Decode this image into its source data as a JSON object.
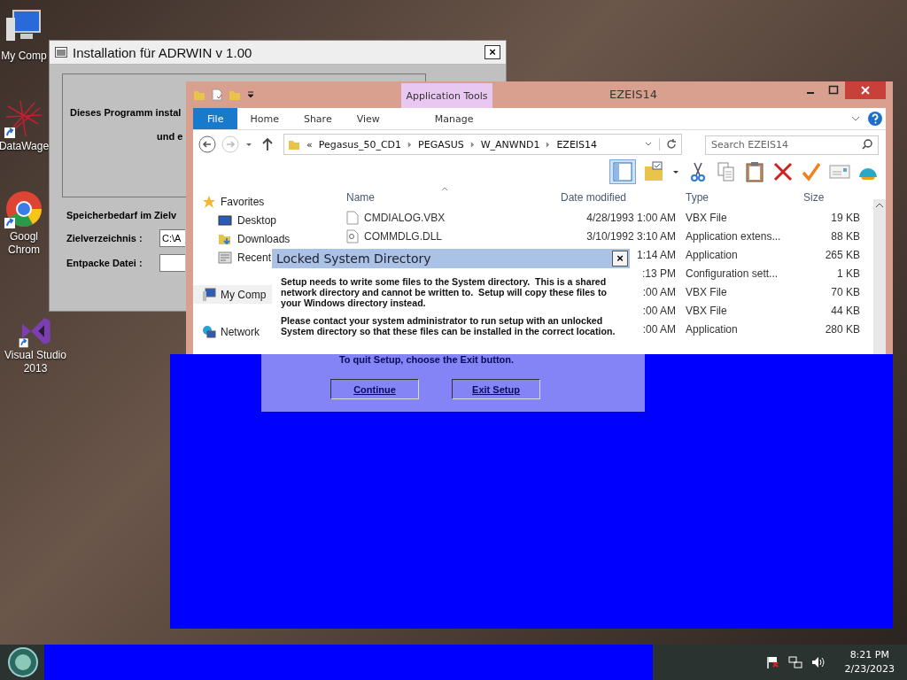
{
  "desktop_icons": [
    {
      "kind": "computer",
      "label": "My Comp",
      "shortcut": false
    },
    {
      "kind": "network-graph",
      "label": "DataWage",
      "shortcut": true
    },
    {
      "kind": "browser",
      "label": "Googl Chrom",
      "shortcut": true
    },
    {
      "kind": "ide",
      "label": "Visual Studio 2013",
      "shortcut": true
    }
  ],
  "installer": {
    "title": "Installation für ADRWIN v 1.00",
    "close": "×",
    "intro_lines": [
      "Dieses Programm instal",
      "und e"
    ],
    "space_label": "Speicherbedarf im Zielv",
    "fields": [
      {
        "label": "Zielverzeichnis :",
        "value": "C:\\A"
      },
      {
        "label": "Entpacke Datei :"
      }
    ]
  },
  "explorer": {
    "title": "EZEIS14",
    "context_tab": "Application Tools",
    "tabs": [
      {
        "label": "File",
        "selected": true
      },
      {
        "label": "Home",
        "selected": false
      },
      {
        "label": "Share",
        "selected": false
      },
      {
        "label": "View",
        "selected": false
      },
      {
        "label": "Manage",
        "selected": false
      }
    ],
    "breadcrumb": {
      "overflow": "«",
      "parts": [
        "Pegasus_50_CD1",
        "PEGASUS",
        "W_ANWND1",
        "EZEIS14"
      ]
    },
    "search": {
      "placeholder": "Search EZEIS14"
    },
    "nav": [
      {
        "kind": "star",
        "label": "Favorites",
        "group": true
      },
      {
        "kind": "desktop",
        "label": "Desktop",
        "group": false
      },
      {
        "kind": "downloads",
        "label": "Downloads",
        "group": false
      },
      {
        "kind": "recent",
        "label": "Recent",
        "group": false
      },
      {
        "kind": "computer",
        "label": "My Comp",
        "group": true
      },
      {
        "kind": "network",
        "label": "Network",
        "group": true
      }
    ],
    "columns": [
      "Name",
      "Date modified",
      "Type",
      "Size"
    ],
    "rows": [
      {
        "kind": "file",
        "name": "CMDIALOG.VBX",
        "date": "4/28/1993 1:00 AM",
        "type": "VBX File",
        "size": "19 KB"
      },
      {
        "kind": "dll",
        "name": "COMMDLG.DLL",
        "date": "3/10/1992 3:10 AM",
        "type": "Application extens...",
        "size": "88 KB"
      },
      {
        "kind": "hidden",
        "date": "1:14 AM",
        "type": "Application",
        "size": "265 KB"
      },
      {
        "kind": "hidden",
        "date": ":13 PM",
        "type": "Configuration sett...",
        "size": "1 KB"
      },
      {
        "kind": "hidden",
        "date": ":00 AM",
        "type": "VBX File",
        "size": "70 KB"
      },
      {
        "kind": "hidden",
        "date": ":00 AM",
        "type": "VBX File",
        "size": "44 KB"
      },
      {
        "kind": "hidden",
        "date": ":00 AM",
        "type": "Application",
        "size": "280 KB"
      }
    ]
  },
  "dialog": {
    "title": "Locked System Directory",
    "close": "×",
    "paragraphs": [
      "Setup needs to write some files to the System directory.  This is a shared network directory and cannot be written to.  Setup will copy these files to your Windows directory instead.",
      "Please contact your system administrator to run setup with an unlocked System directory so that these files can be installed in the correct location."
    ],
    "quit_text": "To quit Setup, choose the Exit button.",
    "buttons": [
      "Continue",
      "Exit Setup"
    ]
  },
  "taskbar": {
    "time": "8:21 PM",
    "date": "2/23/2023"
  }
}
